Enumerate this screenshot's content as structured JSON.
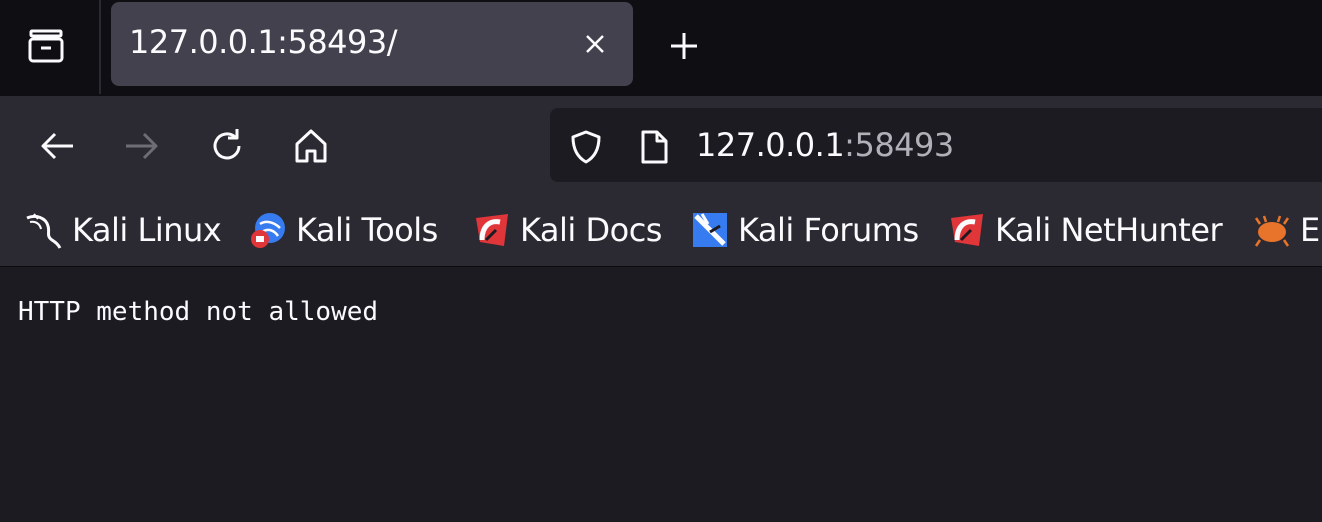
{
  "tab": {
    "title": "127.0.0.1:58493/"
  },
  "url": {
    "host": "127.0.0.1",
    "port": ":58493"
  },
  "bookmarks": [
    {
      "label": "Kali Linux",
      "icon": "kali-dragon-icon"
    },
    {
      "label": "Kali Tools",
      "icon": "kali-tools-icon"
    },
    {
      "label": "Kali Docs",
      "icon": "kali-docs-icon"
    },
    {
      "label": "Kali Forums",
      "icon": "kali-forums-icon"
    },
    {
      "label": "Kali NetHunter",
      "icon": "kali-nethunter-icon"
    },
    {
      "label": "E",
      "icon": "exploit-db-icon"
    }
  ],
  "page": {
    "message": "HTTP method not allowed"
  },
  "colors": {
    "tabbar_bg": "#0f0e13",
    "toolbar_bg": "#2b2a33",
    "page_bg": "#1c1b22",
    "text": "#fbfbfe",
    "kali_red": "#e0363a",
    "kali_blue": "#367bf0"
  }
}
